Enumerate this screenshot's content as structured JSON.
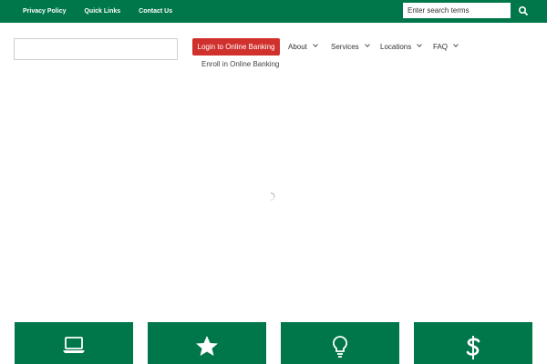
{
  "topbar": {
    "links": [
      "Privacy Policy",
      "Quick Links",
      "Contact Us"
    ],
    "search_placeholder": "Enter search terms",
    "search_icon": "search-icon"
  },
  "header": {
    "login_label": "Login to Online Banking",
    "enroll_label": "Enroll in Online Banking",
    "nav": [
      "About",
      "Services",
      "Locations",
      "FAQ"
    ]
  },
  "cards": {
    "icons": [
      "laptop-icon",
      "star-icon",
      "lightbulb-icon",
      "dollar-icon"
    ]
  },
  "colors": {
    "brand_green": "#00774a",
    "login_red": "#d0312d"
  }
}
